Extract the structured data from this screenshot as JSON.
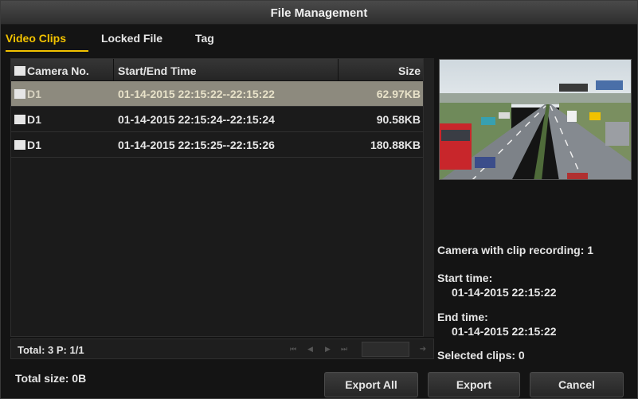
{
  "window": {
    "title": "File Management"
  },
  "tabs": [
    {
      "label": "Video Clips",
      "active": true
    },
    {
      "label": "Locked File",
      "active": false
    },
    {
      "label": "Tag",
      "active": false
    }
  ],
  "table": {
    "columns": [
      "Camera No.",
      "Start/End Time",
      "Size"
    ],
    "rows": [
      {
        "camera": "D1",
        "time": "01-14-2015 22:15:22--22:15:22",
        "size": "62.97KB",
        "selected": true
      },
      {
        "camera": "D1",
        "time": "01-14-2015 22:15:24--22:15:24",
        "size": "90.58KB",
        "selected": false
      },
      {
        "camera": "D1",
        "time": "01-14-2015 22:15:25--22:15:26",
        "size": "180.88KB",
        "selected": false
      }
    ]
  },
  "pager": {
    "total": "Total: 3  P: 1/1"
  },
  "info": {
    "camera_with_clip": "Camera with clip recording: 1",
    "start_label": "Start time:",
    "start_value": "01-14-2015 22:15:22",
    "end_label": "End time:",
    "end_value": "01-14-2015 22:15:22",
    "selected_clips": "Selected clips: 0"
  },
  "footer": {
    "total_size": "Total size: 0B",
    "export_all": "Export All",
    "export": "Export",
    "cancel": "Cancel"
  },
  "colors": {
    "accent": "#f2c200",
    "selected_row": "#8d8a7e",
    "background": "#141414"
  }
}
